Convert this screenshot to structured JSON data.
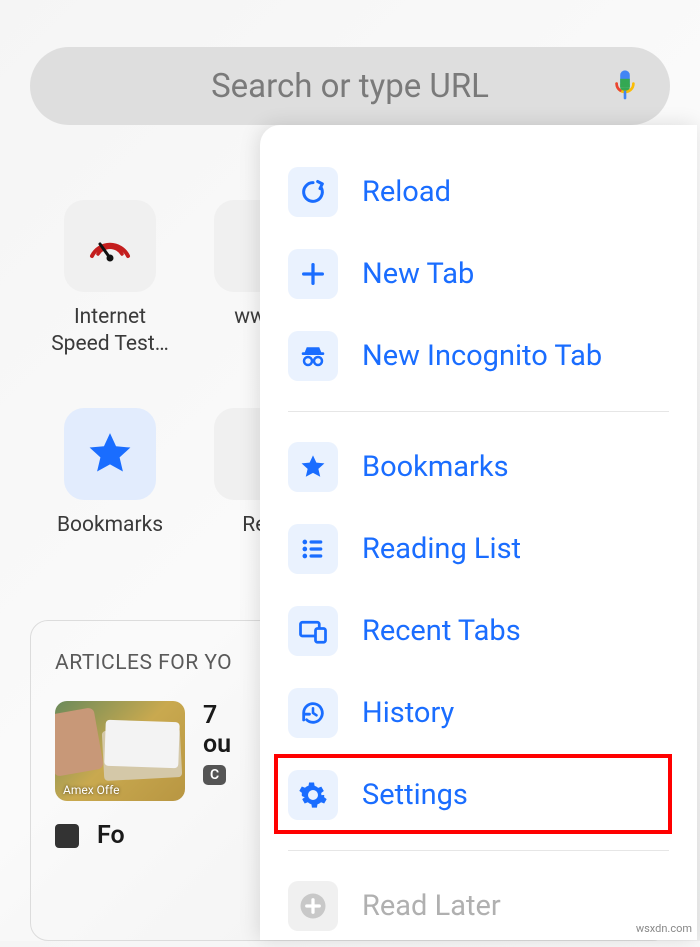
{
  "search": {
    "placeholder": "Search or type URL"
  },
  "shortcuts": {
    "speedtest": "Internet Speed Test…",
    "www": "www.",
    "bookmarks": "Bookmarks",
    "reading": "Rea"
  },
  "articles": {
    "heading": "ARTICLES FOR YO",
    "item1_title": "7 ",
    "item1_line2": "ou",
    "item1_badge": "C",
    "item1_thumb_caption": "Amex Offe",
    "item2_title": "Fo"
  },
  "menu": {
    "reload": "Reload",
    "new_tab": "New Tab",
    "new_incognito": "New Incognito Tab",
    "bookmarks": "Bookmarks",
    "reading_list": "Reading List",
    "recent_tabs": "Recent Tabs",
    "history": "History",
    "settings": "Settings",
    "read_later": "Read Later"
  },
  "watermark": "wsxdn.com"
}
